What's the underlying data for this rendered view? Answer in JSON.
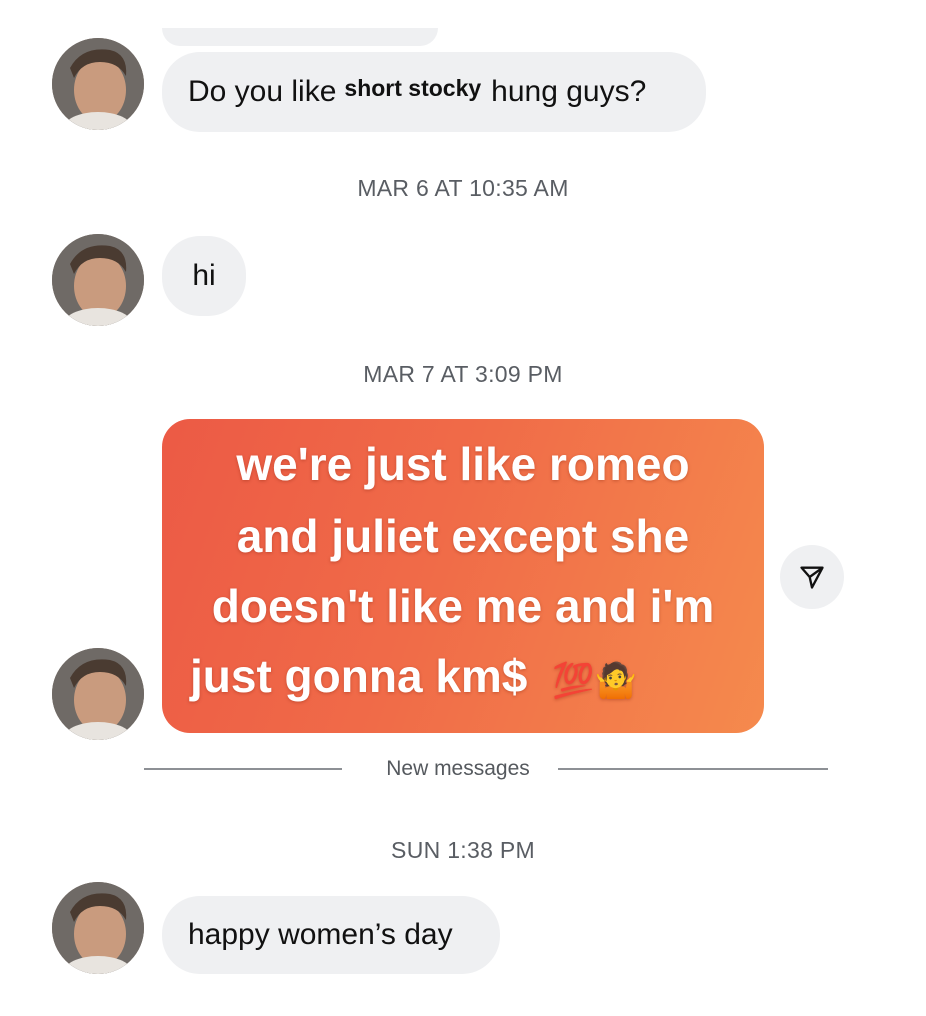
{
  "messages": {
    "m1": {
      "before": "Do you like",
      "bold": "short stocky",
      "after": "hung guys?"
    },
    "ts1": "MAR 6 AT 10:35 AM",
    "m2": {
      "text": "hi"
    },
    "ts2": "MAR 7 AT 3:09 PM",
    "meme": {
      "line1": "we're just like romeo",
      "line2": "and juliet except she",
      "line3": "doesn't like me and i'm",
      "line4": "just gonna km$",
      "emoji": "💯🤷"
    },
    "divider": "New messages",
    "ts3": "SUN 1:38 PM",
    "m3": {
      "text": "happy women’s day"
    }
  },
  "icons": {
    "avatar": "avatar-photo",
    "share": "send-icon"
  },
  "colors": {
    "bubble": "#eff0f2",
    "meme_start": "#ec5a45",
    "meme_end": "#f58a4d"
  }
}
